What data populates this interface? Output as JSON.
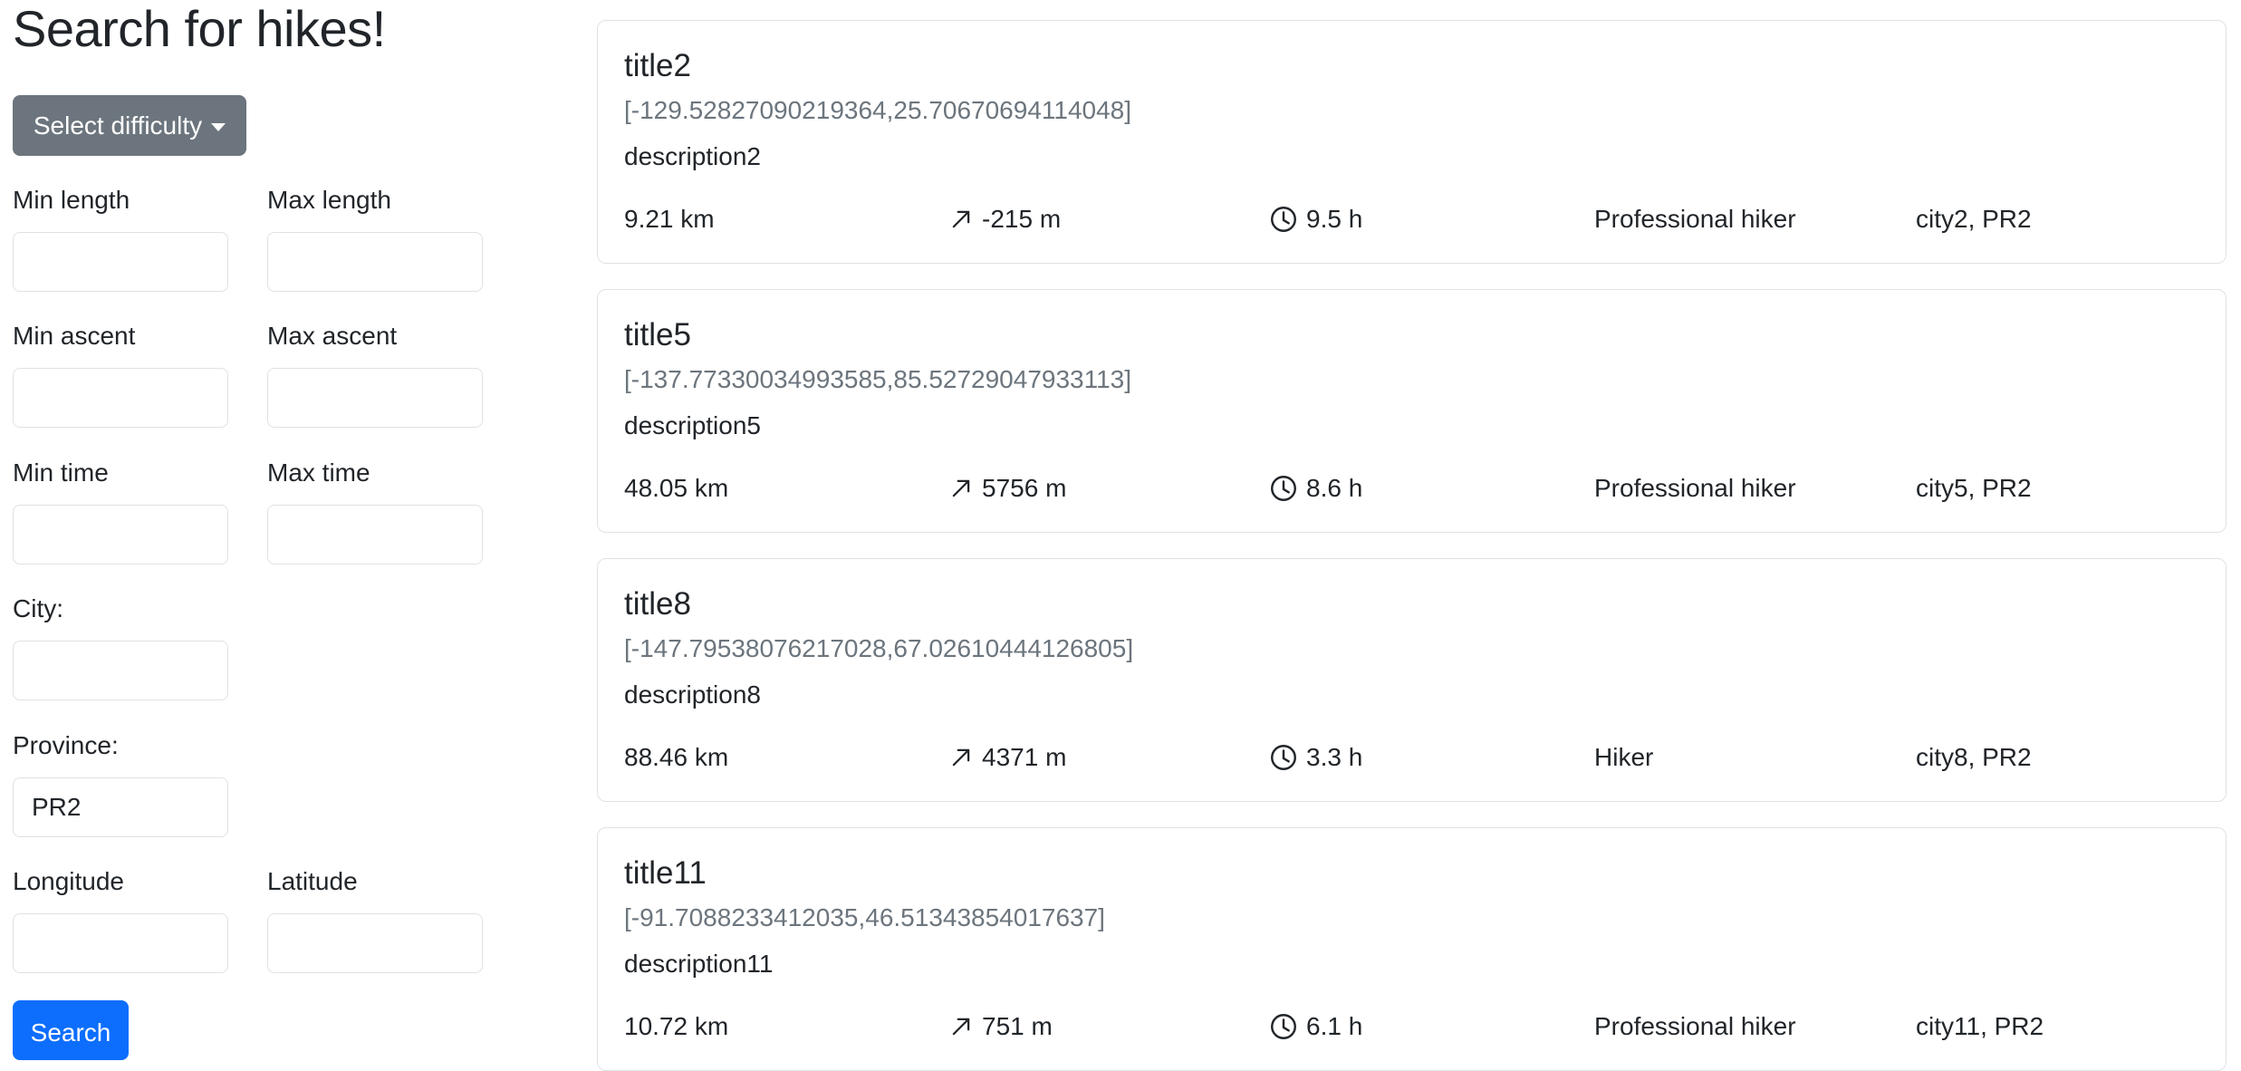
{
  "page": {
    "title": "Search for hikes!"
  },
  "filters": {
    "difficulty_label": "Select difficulty",
    "min_length_label": "Min length",
    "max_length_label": "Max length",
    "min_ascent_label": "Min ascent",
    "max_ascent_label": "Max ascent",
    "min_time_label": "Min time",
    "max_time_label": "Max time",
    "city_label": "City:",
    "province_label": "Province:",
    "province_value": "PR2",
    "longitude_label": "Longitude",
    "latitude_label": "Latitude",
    "search_label": "Search"
  },
  "hikes": [
    {
      "title": "title2",
      "coords": "[-129.52827090219364,25.70670694114048]",
      "description": "description2",
      "length": "9.21 km",
      "ascent": "-215 m",
      "time": "9.5 h",
      "difficulty": "Professional hiker",
      "location": "city2, PR2"
    },
    {
      "title": "title5",
      "coords": "[-137.77330034993585,85.52729047933113]",
      "description": "description5",
      "length": "48.05 km",
      "ascent": "5756 m",
      "time": "8.6 h",
      "difficulty": "Professional hiker",
      "location": "city5, PR2"
    },
    {
      "title": "title8",
      "coords": "[-147.79538076217028,67.02610444126805]",
      "description": "description8",
      "length": "88.46 km",
      "ascent": "4371 m",
      "time": "3.3 h",
      "difficulty": "Hiker",
      "location": "city8, PR2"
    },
    {
      "title": "title11",
      "coords": "[-91.7088233412035,46.51343854017637]",
      "description": "description11",
      "length": "10.72 km",
      "ascent": "751 m",
      "time": "6.1 h",
      "difficulty": "Professional hiker",
      "location": "city11, PR2"
    }
  ],
  "icons": {
    "ascent": "arrow-up-right-icon",
    "time": "clock-icon",
    "difficulty_caret": "caret-down-icon"
  }
}
